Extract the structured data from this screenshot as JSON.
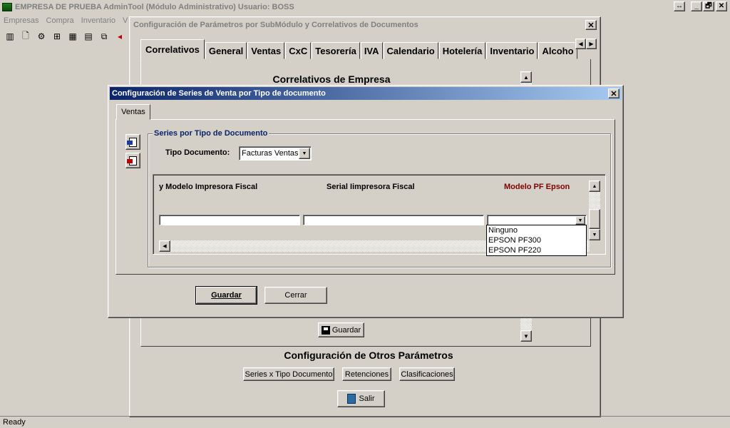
{
  "app": {
    "title": "EMPRESA DE PRUEBA  AdminTool (Módulo Administrativo) Usuario: BOSS",
    "window_buttons": {
      "restore_size": "↔",
      "minimize": "_",
      "maximize": "🗗",
      "close": "✕"
    },
    "menu": [
      "Empresas",
      "Compra",
      "Inventario",
      "V"
    ],
    "toolbar_icons": [
      "columns-icon",
      "new-doc-icon",
      "settings-tree-icon",
      "hierarchy-icon",
      "calendar-grid-icon",
      "report-icon",
      "copy-icon",
      "arrow-icon"
    ],
    "status": "Ready"
  },
  "config_window": {
    "title": "Configuración de Parámetros por SubMódulo y Correlativos de Documentos",
    "close": "✕",
    "tabs": [
      "Correlativos",
      "General",
      "Ventas",
      "CxC",
      "Tesorería",
      "IVA",
      "Calendario",
      "Hotelería",
      "Inventario",
      "Alcoho"
    ],
    "active_tab": "Correlativos",
    "section_title": "Correlativos de Empresa",
    "guardar_label": "Guardar",
    "otros_title": "Configuración de Otros Parámetros",
    "buttons": {
      "series": "Series x Tipo Documento",
      "retenciones": "Retenciones",
      "clasificaciones": "Clasificaciones",
      "salir": "Salir"
    }
  },
  "series_dialog": {
    "title": "Configuración de Series de Venta por Tipo de documento",
    "close": "✕",
    "tab": "Ventas",
    "group_label": "Series por Tipo de Documento",
    "tipo_label": "Tipo Documento:",
    "tipo_value": "Facturas Ventas",
    "columns": {
      "modelo": "y Modelo Impresora Fiscal",
      "serial": "Serial Iimpresora Fiscal",
      "epson": "Modelo PF Epson"
    },
    "epson_options": [
      "Ninguno",
      "EPSON PF300",
      "EPSON PF220"
    ],
    "guardar": "Guardar",
    "cerrar": "Cerrar"
  },
  "colors": {
    "active_title_start": "#0a246a",
    "active_title_end": "#a6caf0",
    "group_label": "#0a246a",
    "epson_header": "#800000",
    "face": "#d4d0c8"
  }
}
